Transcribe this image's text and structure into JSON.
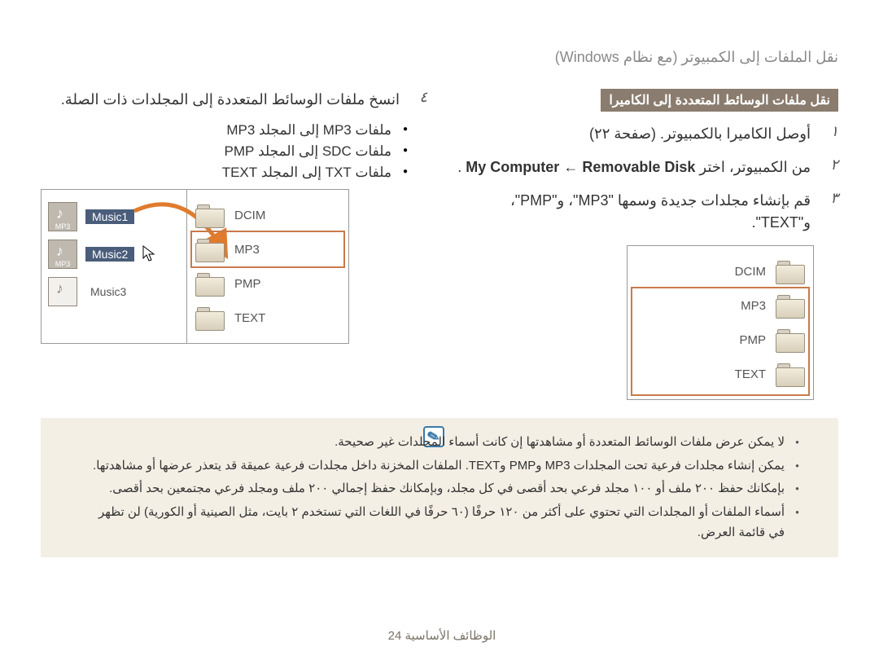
{
  "page_title": "نقل الملفات إلى الكمبيوتر (مع نظام Windows)",
  "right": {
    "heading": "نقل ملفات الوسائط المتعددة إلى الكاميرا",
    "steps": [
      {
        "num": "١",
        "text": "أوصل الكاميرا بالكمبيوتر. (صفحة ٢٢)"
      },
      {
        "num": "٢",
        "pre": "من الكمبيوتر، اختر ",
        "en1": "My Computer",
        "arrow": " ← ",
        "en2": "Removable Disk",
        "post": "."
      },
      {
        "num": "٣",
        "text": "قم بإنشاء مجلدات جديدة وسمها \"MP3\"، و\"PMP\"، و\"TEXT\"."
      }
    ],
    "folders": [
      "DCIM",
      "MP3",
      "PMP",
      "TEXT"
    ]
  },
  "left": {
    "step4": {
      "num": "٤",
      "text": "انسخ ملفات الوسائط المتعددة إلى المجلدات ذات الصلة."
    },
    "bullets": [
      "ملفات MP3 إلى المجلد MP3",
      "ملفات SDC إلى المجلد PMP",
      "ملفات TXT إلى المجلد TEXT"
    ],
    "musiclist": [
      {
        "label": "Music1",
        "selected": true
      },
      {
        "label": "Music2",
        "selected": true
      },
      {
        "label": "Music3",
        "selected": false
      }
    ],
    "folders": [
      "DCIM",
      "MP3",
      "PMP",
      "TEXT"
    ]
  },
  "notes": [
    "لا يمكن عرض ملفات الوسائط المتعددة أو مشاهدتها إن كانت أسماء المجلدات غير صحيحة.",
    "يمكن إنشاء مجلدات فرعية تحت المجلدات MP3 وPMP وTEXT. الملفات المخزنة داخل مجلدات فرعية عميقة قد يتعذر عرضها أو مشاهدتها.",
    "بإمكانك حفظ ٢٠٠ ملف أو ١٠٠ مجلد فرعي بحد أقصى في كل مجلد، وبإمكانك حفظ إجمالي ٢٠٠ ملف ومجلد فرعي مجتمعين بحد أقصى.",
    "أسماء الملفات أو المجلدات التي تحتوي على أكثر من ١٢٠ حرفًا (٦٠ حرفًا في اللغات التي تستخدم ٢ بايت، مثل الصينية أو الكورية) لن تظهر في قائمة العرض."
  ],
  "footer": {
    "label": "الوظائف الأساسية",
    "page": "24"
  },
  "icon_tags": {
    "mp3": "MP3",
    "note_glyph": "✎"
  }
}
